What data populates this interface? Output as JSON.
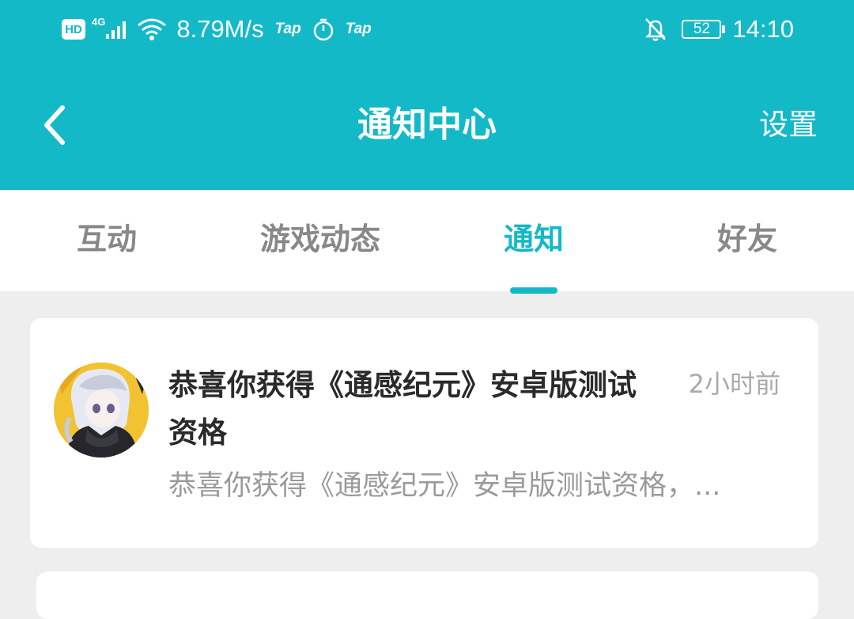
{
  "status_bar": {
    "hd_badge": "HD",
    "network_type": "4G",
    "speed": "8.79M/s",
    "tap_label_1": "Tap",
    "tap_label_2": "Tap",
    "battery": "52",
    "time": "14:10",
    "icons": [
      "signal-icon",
      "wifi-icon",
      "timer-icon",
      "bell-off-icon"
    ]
  },
  "header": {
    "back_icon": "chevron-left-icon",
    "title": "通知中心",
    "settings_label": "设置"
  },
  "tabs": [
    {
      "label": "互动",
      "active": false
    },
    {
      "label": "游戏动态",
      "active": false
    },
    {
      "label": "通知",
      "active": true
    },
    {
      "label": "好友",
      "active": false
    }
  ],
  "notifications": [
    {
      "avatar": "game-character-avatar",
      "title": "恭喜你获得《通感纪元》安卓版测试资格",
      "time": "2小时前",
      "preview": "恭喜你获得《通感纪元》安卓版测试资格，..."
    }
  ],
  "colors": {
    "brand": "#14b9c8",
    "background": "#eeeeee",
    "card": "#ffffff",
    "title_text": "#2a2a2a",
    "muted_text": "#aaaaaa"
  }
}
